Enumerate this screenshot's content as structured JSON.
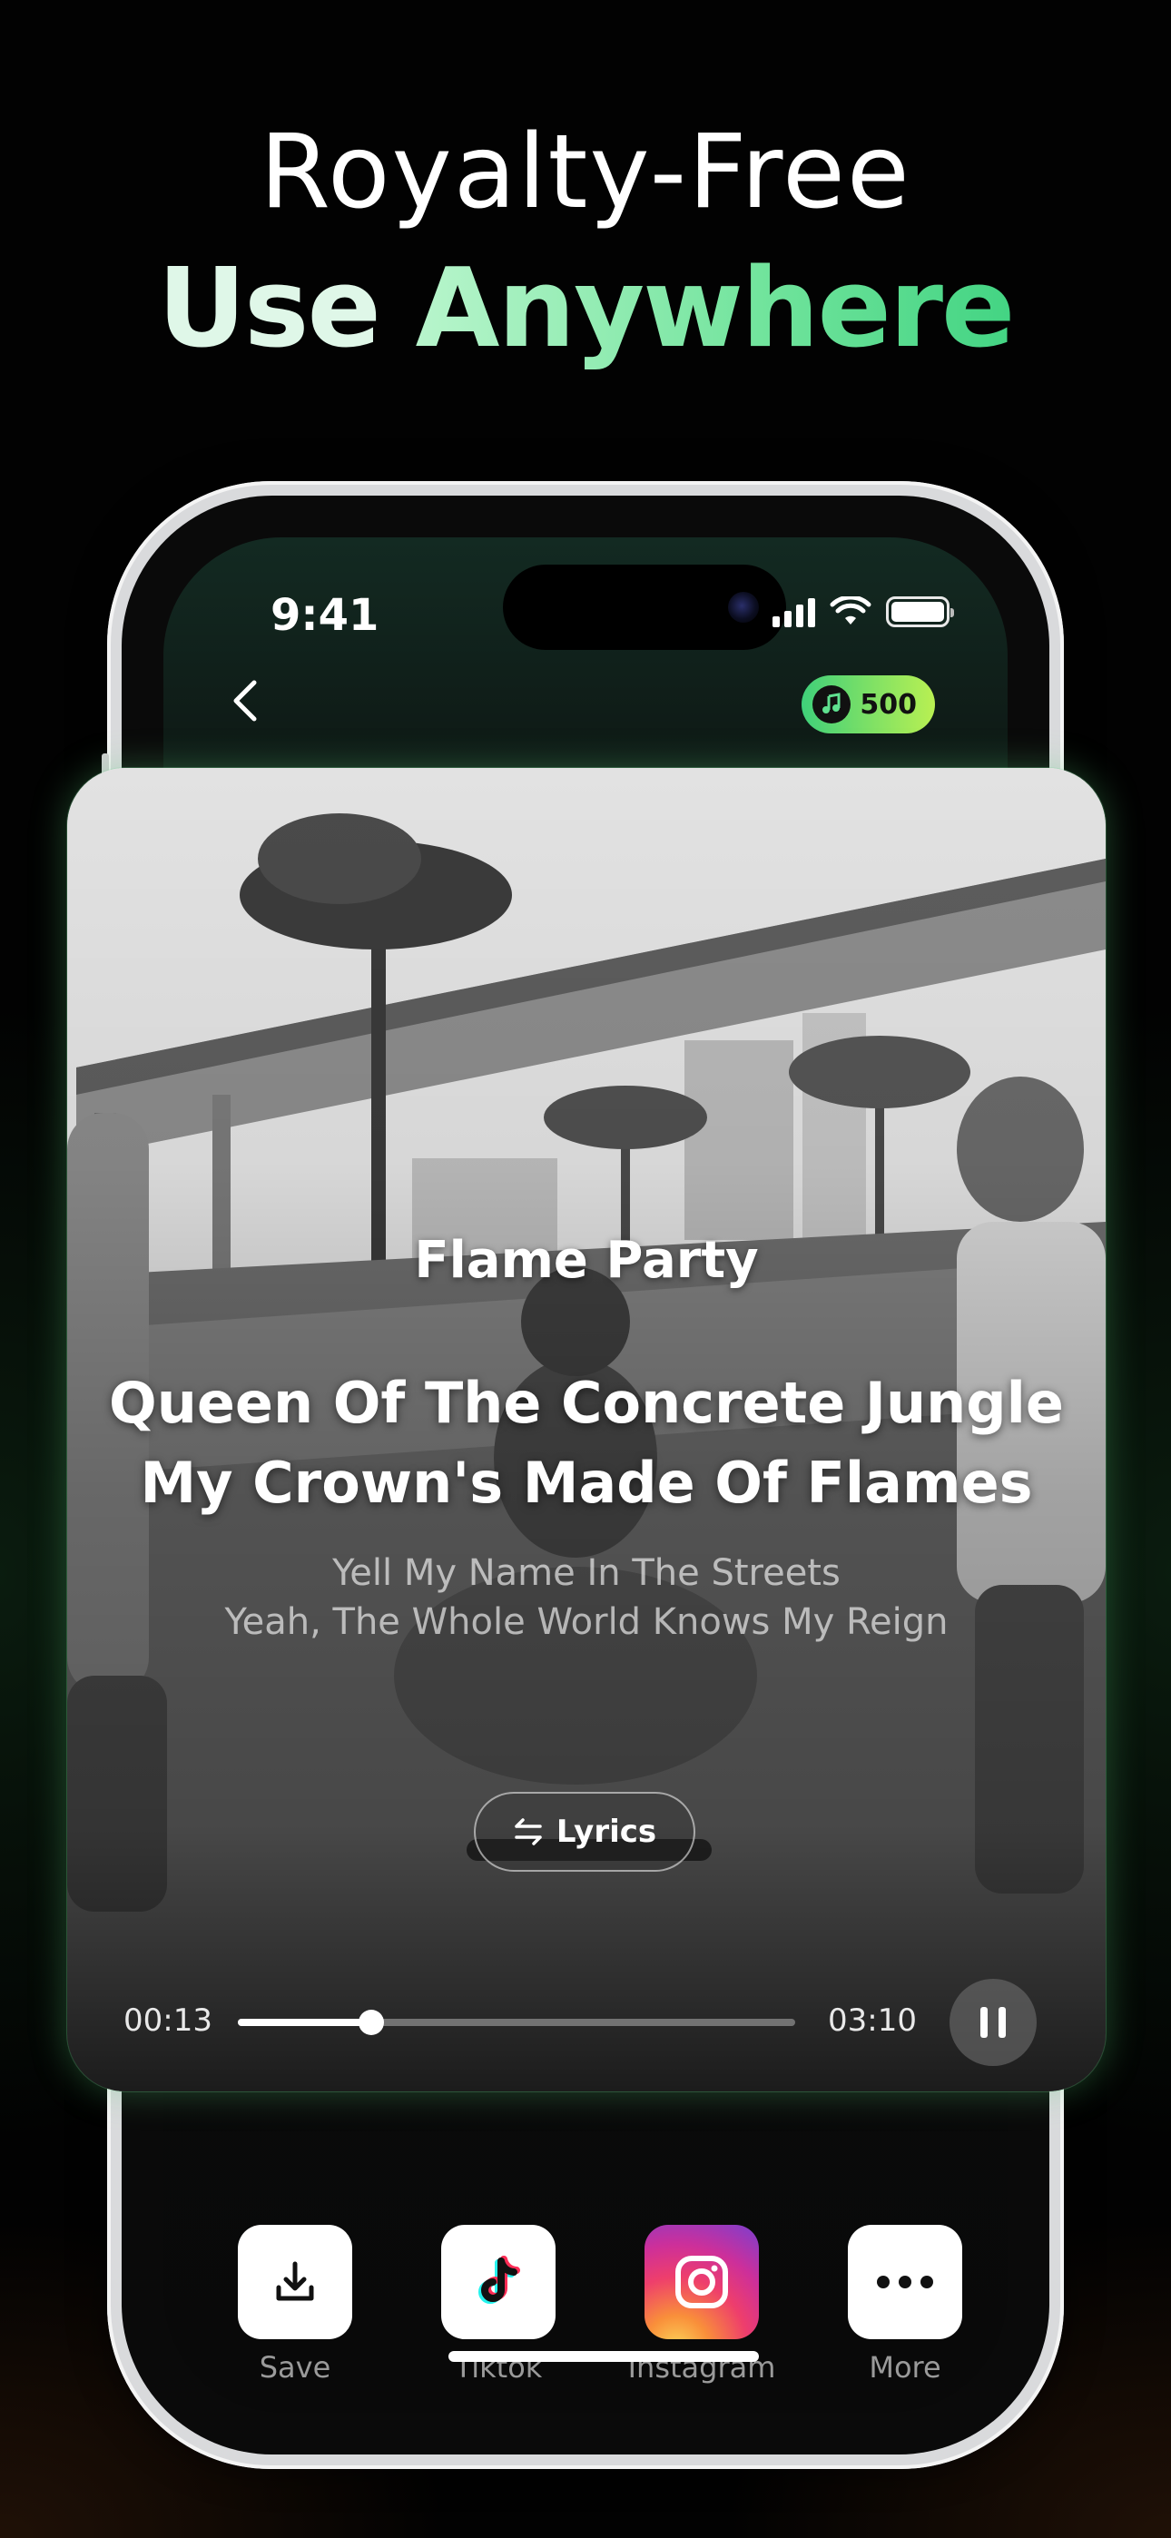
{
  "headline": {
    "line1": "Royalty-Free",
    "line2_word1": "Use",
    "line2_word2": "Anywhere"
  },
  "status_bar": {
    "time": "9:41",
    "icons": [
      "cellular-signal-icon",
      "wifi-icon",
      "battery-icon"
    ]
  },
  "header": {
    "back_icon": "chevron-left-icon",
    "coin_icon": "music-note-icon",
    "coins": "500"
  },
  "song": {
    "title": "Flame Party",
    "lyric_current_1": "Queen Of The Concrete Jungle",
    "lyric_current_2": "My Crown's Made Of Flames",
    "lyric_next_1": "Yell My Name In The Streets",
    "lyric_next_2": "Yeah, The Whole World Knows My Reign",
    "lyrics_button": "Lyrics",
    "lyrics_icon": "swap-arrows-icon"
  },
  "player": {
    "current_time": "00:13",
    "total_time": "03:10",
    "progress_fraction": 0.24,
    "state_icon": "pause-icon"
  },
  "share": [
    {
      "label": "Save",
      "icon": "download-icon"
    },
    {
      "label": "Tiktok",
      "icon": "tiktok-icon"
    },
    {
      "label": "Instagram",
      "icon": "instagram-icon"
    },
    {
      "label": "More",
      "icon": "more-dots-icon"
    }
  ],
  "colors": {
    "accent_green": "#43d483",
    "badge_gradient_start": "#3fd07a",
    "badge_gradient_end": "#b9f052"
  }
}
